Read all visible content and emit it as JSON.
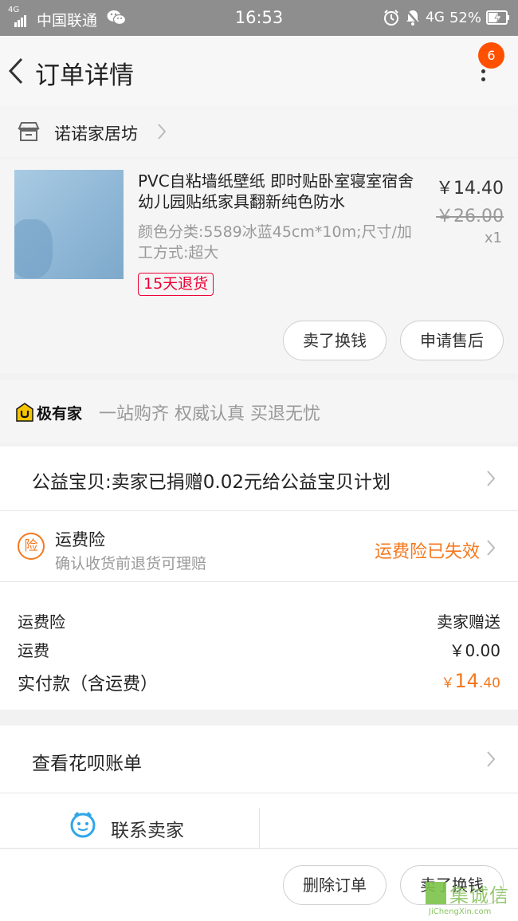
{
  "status_bar": {
    "network_type": "4G",
    "carrier": "中国联通",
    "time": "16:53",
    "network_right": "4G",
    "battery": "52%"
  },
  "nav": {
    "title": "订单详情",
    "badge_count": "6"
  },
  "shop": {
    "name": "诺诺家居坊"
  },
  "product": {
    "title": "PVC自粘墙纸壁纸 即时贴卧室寝室宿舍幼儿园贴纸家具翻新纯色防水",
    "sku": "颜色分类:5589冰蓝45cm*10m;尺寸/加工方式:超大",
    "return_tag": "15天退货",
    "price": "￥14.40",
    "original_price": "￥26.00",
    "quantity": "x1",
    "thumb_color": "#9cc3e0",
    "buttons": {
      "sell_for_cash": "卖了换钱",
      "after_sale": "申请售后"
    }
  },
  "jiyoujia": {
    "brand": "极有家",
    "slogan": "一站购齐 权威认真 买退无忧"
  },
  "charity": {
    "text": "公益宝贝:卖家已捐赠0.02元给公益宝贝计划"
  },
  "insurance": {
    "icon_text": "险",
    "title": "运费险",
    "subtitle": "确认收货前退货可理赔",
    "status": "运费险已失效"
  },
  "fees": {
    "insurance_label": "运费险",
    "insurance_value": "卖家赠送",
    "shipping_label": "运费",
    "shipping_value": "￥0.00",
    "paid_label": "实付款（含运费）",
    "paid_currency": "￥",
    "paid_integer": "14",
    "paid_decimal": ".40"
  },
  "huabei": {
    "text": "查看花呗账单"
  },
  "contact": {
    "text": "联系卖家"
  },
  "bottom_bar": {
    "delete_order": "删除订单",
    "sell_for_cash": "卖了换钱"
  },
  "watermark": {
    "cn": "集诚信",
    "en": "JiChengXin.com"
  },
  "colors": {
    "accent_orange": "#f5781e",
    "badge": "#ff5000",
    "return_tag_red": "#e03",
    "contact_blue": "#2fa6e8"
  }
}
